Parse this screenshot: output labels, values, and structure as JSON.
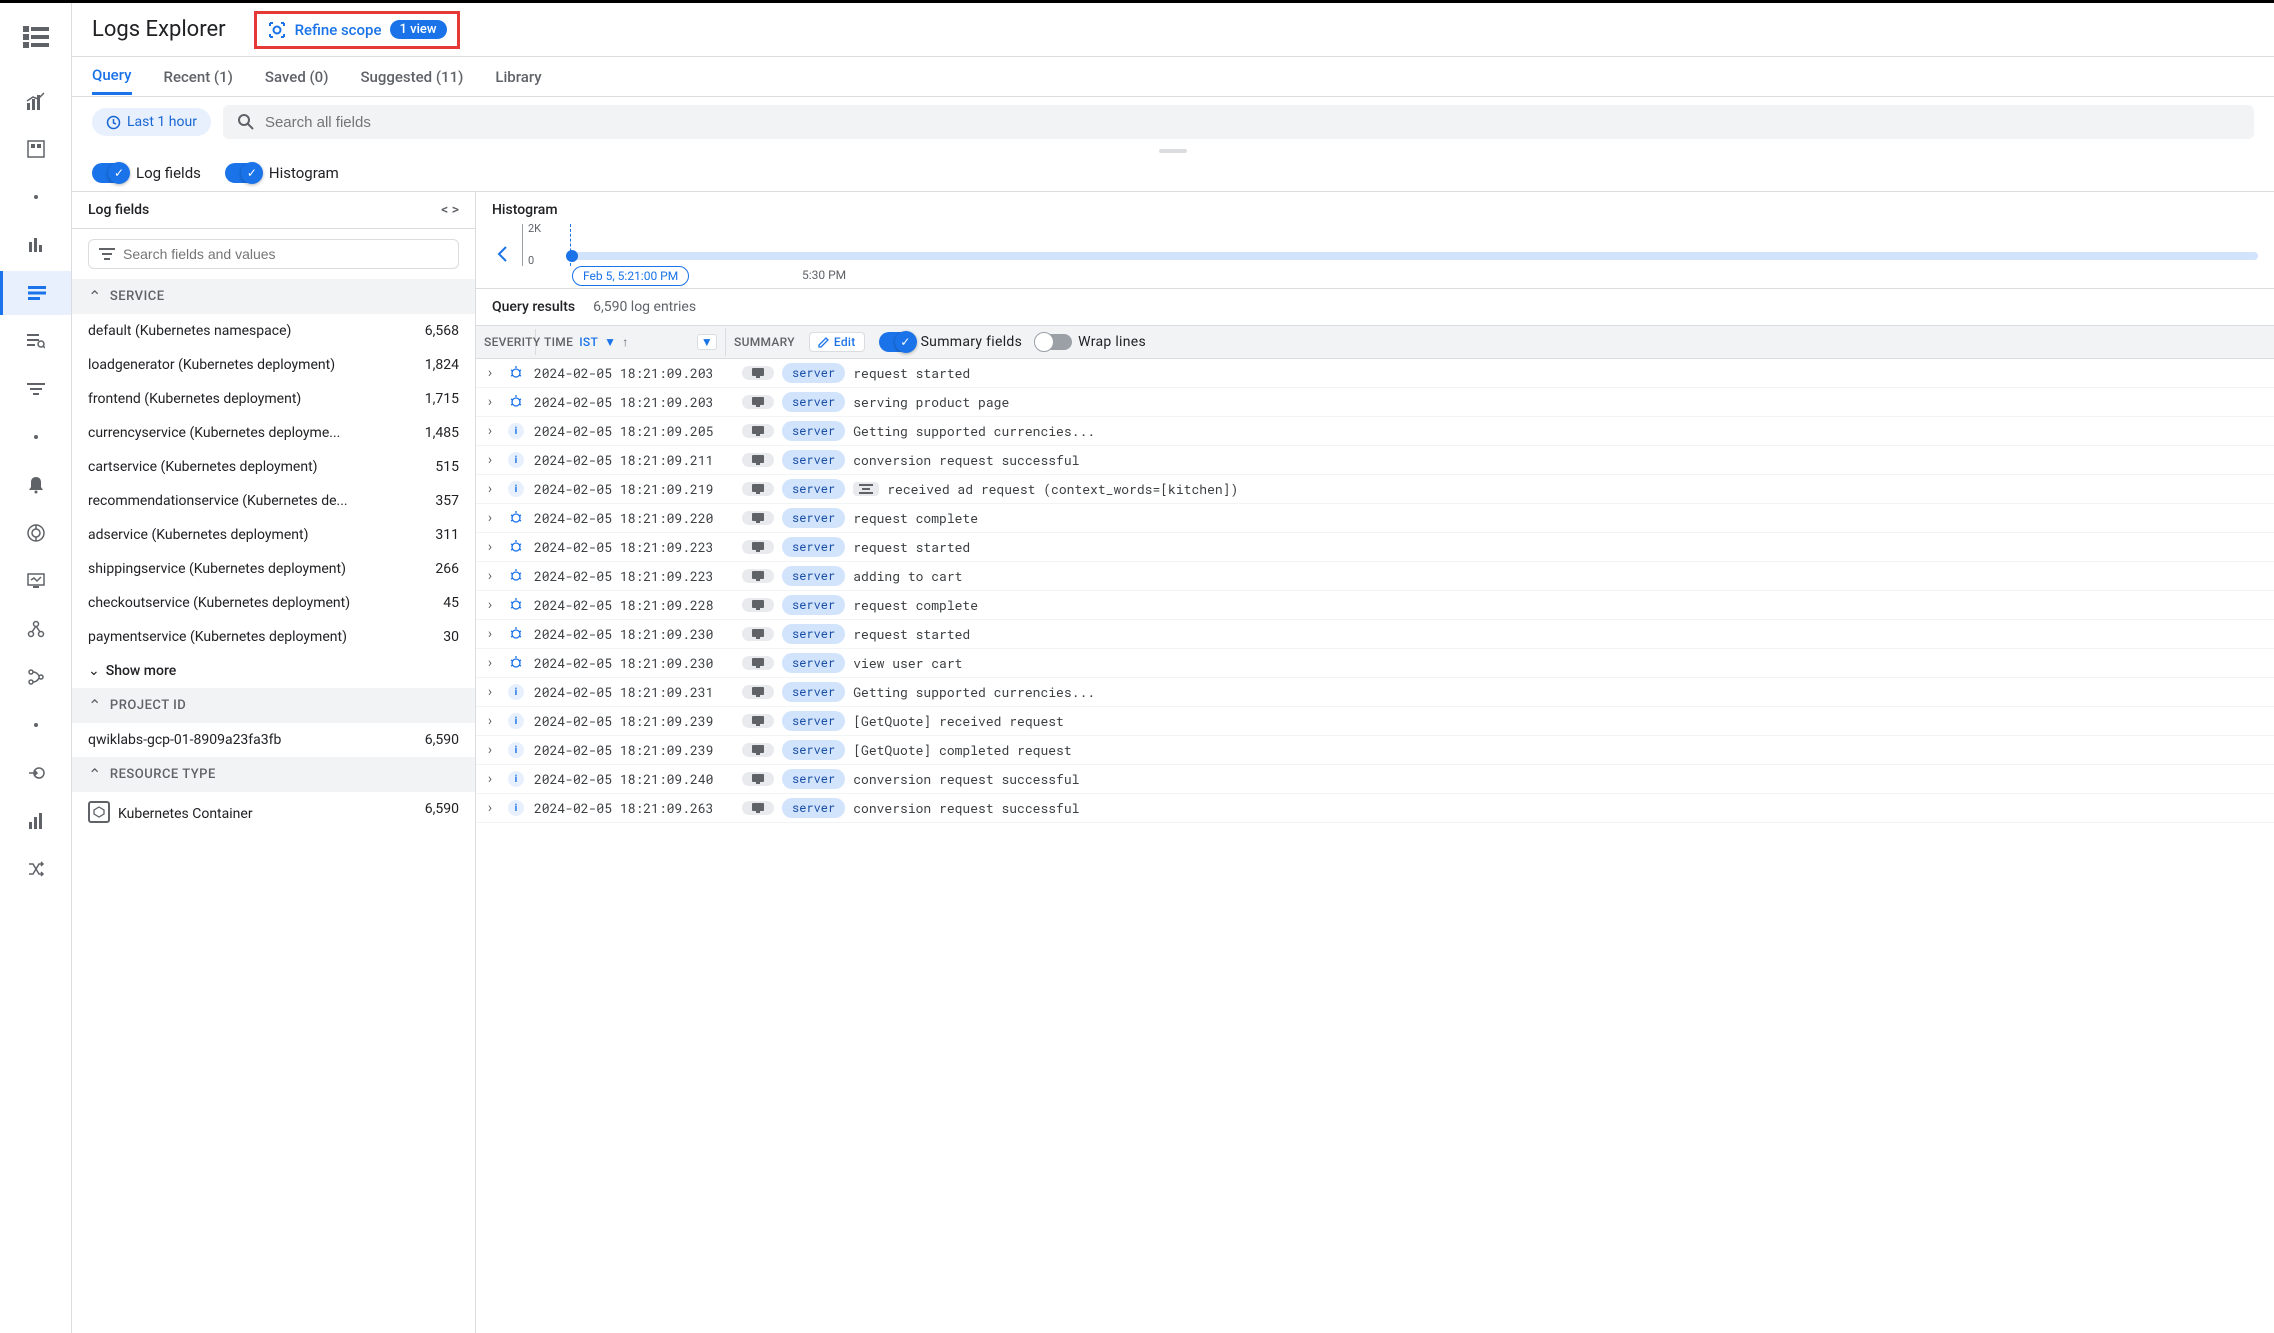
{
  "header": {
    "title": "Logs Explorer",
    "refine": {
      "label": "Refine scope",
      "badge": "1 view"
    }
  },
  "tabs": [
    {
      "label": "Query",
      "active": true
    },
    {
      "label": "Recent (1)"
    },
    {
      "label": "Saved (0)"
    },
    {
      "label": "Suggested (11)"
    },
    {
      "label": "Library"
    }
  ],
  "timeFilter": {
    "label": "Last 1 hour"
  },
  "search": {
    "placeholder": "Search all fields"
  },
  "toggles": {
    "logFields": "Log fields",
    "histogram": "Histogram"
  },
  "logFieldsPanel": {
    "title": "Log fields",
    "searchPlaceholder": "Search fields and values",
    "showMore": "Show more",
    "sections": [
      {
        "title": "SERVICE",
        "items": [
          {
            "name": "default (Kubernetes namespace)",
            "count": "6,568"
          },
          {
            "name": "loadgenerator (Kubernetes deployment)",
            "count": "1,824"
          },
          {
            "name": "frontend (Kubernetes deployment)",
            "count": "1,715"
          },
          {
            "name": "currencyservice (Kubernetes deployme...",
            "count": "1,485"
          },
          {
            "name": "cartservice (Kubernetes deployment)",
            "count": "515"
          },
          {
            "name": "recommendationservice (Kubernetes de...",
            "count": "357"
          },
          {
            "name": "adservice (Kubernetes deployment)",
            "count": "311"
          },
          {
            "name": "shippingservice (Kubernetes deployment)",
            "count": "266"
          },
          {
            "name": "checkoutservice (Kubernetes deployment)",
            "count": "45"
          },
          {
            "name": "paymentservice (Kubernetes deployment)",
            "count": "30"
          }
        ]
      },
      {
        "title": "PROJECT ID",
        "items": [
          {
            "name": "qwiklabs-gcp-01-8909a23fa3fb",
            "count": "6,590"
          }
        ]
      },
      {
        "title": "RESOURCE TYPE",
        "items": [
          {
            "name": "Kubernetes Container",
            "count": "6,590",
            "icon": "k8s"
          }
        ]
      }
    ]
  },
  "histogramSection": {
    "title": "Histogram",
    "yMax": "2K",
    "yMin": "0",
    "timePill": "Feb 5, 5:21:00 PM",
    "tick1": "5:30 PM"
  },
  "results": {
    "title": "Query results",
    "count": "6,590 log entries",
    "columns": {
      "severity": "SEVERITY",
      "time": "TIME",
      "tz": "IST",
      "summary": "SUMMARY",
      "edit": "Edit",
      "summaryFields": "Summary fields",
      "wrapLines": "Wrap lines"
    },
    "rows": [
      {
        "sev": "debug",
        "ts": "2024-02-05 18:21:09.203",
        "tag": "server",
        "msg": "request started"
      },
      {
        "sev": "debug",
        "ts": "2024-02-05 18:21:09.203",
        "tag": "server",
        "msg": "serving product page"
      },
      {
        "sev": "info",
        "ts": "2024-02-05 18:21:09.205",
        "tag": "server",
        "msg": "Getting supported currencies..."
      },
      {
        "sev": "info",
        "ts": "2024-02-05 18:21:09.211",
        "tag": "server",
        "msg": "conversion request successful"
      },
      {
        "sev": "info",
        "ts": "2024-02-05 18:21:09.219",
        "tag": "server",
        "msg": "received ad request (context_words=[kitchen])",
        "align": true
      },
      {
        "sev": "debug",
        "ts": "2024-02-05 18:21:09.220",
        "tag": "server",
        "msg": "request complete"
      },
      {
        "sev": "debug",
        "ts": "2024-02-05 18:21:09.223",
        "tag": "server",
        "msg": "request started"
      },
      {
        "sev": "debug",
        "ts": "2024-02-05 18:21:09.223",
        "tag": "server",
        "msg": "adding to cart"
      },
      {
        "sev": "debug",
        "ts": "2024-02-05 18:21:09.228",
        "tag": "server",
        "msg": "request complete"
      },
      {
        "sev": "debug",
        "ts": "2024-02-05 18:21:09.230",
        "tag": "server",
        "msg": "request started"
      },
      {
        "sev": "debug",
        "ts": "2024-02-05 18:21:09.230",
        "tag": "server",
        "msg": "view user cart"
      },
      {
        "sev": "info",
        "ts": "2024-02-05 18:21:09.231",
        "tag": "server",
        "msg": "Getting supported currencies..."
      },
      {
        "sev": "info",
        "ts": "2024-02-05 18:21:09.239",
        "tag": "server",
        "msg": "[GetQuote] received request"
      },
      {
        "sev": "info",
        "ts": "2024-02-05 18:21:09.239",
        "tag": "server",
        "msg": "[GetQuote] completed request"
      },
      {
        "sev": "info",
        "ts": "2024-02-05 18:21:09.240",
        "tag": "server",
        "msg": "conversion request successful"
      },
      {
        "sev": "info",
        "ts": "2024-02-05 18:21:09.263",
        "tag": "server",
        "msg": "conversion request successful"
      }
    ]
  }
}
